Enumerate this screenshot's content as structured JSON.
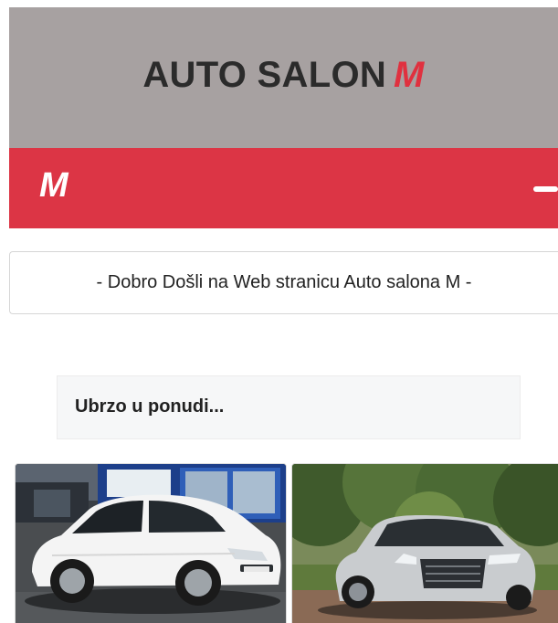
{
  "header": {
    "title_main": "AUTO SALON",
    "title_mark": "M",
    "background_color": "#a7a1a1",
    "mark_color": "#e0313f"
  },
  "navbar": {
    "brand": "M",
    "background_color": "#dc3545",
    "toggler_icon": "menu-icon"
  },
  "welcome": {
    "text": "- Dobro Došli na Web stranicu Auto salona M -"
  },
  "coming_soon": {
    "heading": "Ubrzo u ponudi..."
  },
  "cars": [
    {
      "name": "white-hatchback",
      "color": "#ffffff"
    },
    {
      "name": "silver-sedan",
      "color": "#c9cccf"
    }
  ]
}
